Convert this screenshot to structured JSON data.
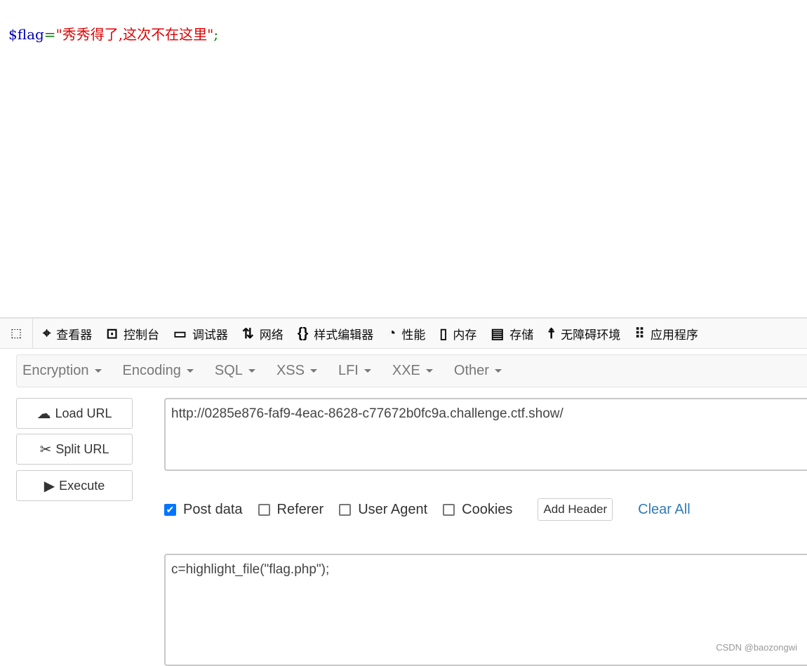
{
  "page_output": {
    "var": "$flag",
    "eq": "=",
    "str": "\"秀秀得了,这次不在这里\"",
    "semi": ";"
  },
  "devtools": {
    "tools": [
      {
        "icon": "inspector-icon",
        "label": "查看器"
      },
      {
        "icon": "console-icon",
        "label": "控制台"
      },
      {
        "icon": "debugger-icon",
        "label": "调试器"
      },
      {
        "icon": "network-icon",
        "label": "网络"
      },
      {
        "icon": "style-editor-icon",
        "label": "样式编辑器"
      },
      {
        "icon": "performance-icon",
        "label": "性能"
      },
      {
        "icon": "memory-icon",
        "label": "内存"
      },
      {
        "icon": "storage-icon",
        "label": "存储"
      },
      {
        "icon": "accessibility-icon",
        "label": "无障碍环境"
      },
      {
        "icon": "apps-icon",
        "label": "应用程序"
      }
    ]
  },
  "hackbar": {
    "menu": [
      "Encryption",
      "Encoding",
      "SQL",
      "XSS",
      "LFI",
      "XXE",
      "Other"
    ],
    "buttons": {
      "load": "Load URL",
      "split": "Split URL",
      "execute": "Execute"
    },
    "url": "http://0285e876-faf9-4eac-8628-c77672b0fc9a.challenge.ctf.show/",
    "options": {
      "post": "Post data",
      "referer": "Referer",
      "ua": "User Agent",
      "cookies": "Cookies",
      "post_checked": true
    },
    "add_header": "Add Header",
    "clear_all": "Clear All",
    "post_body": "c=highlight_file(\"flag.php\");"
  },
  "watermark": "CSDN @baozongwi"
}
